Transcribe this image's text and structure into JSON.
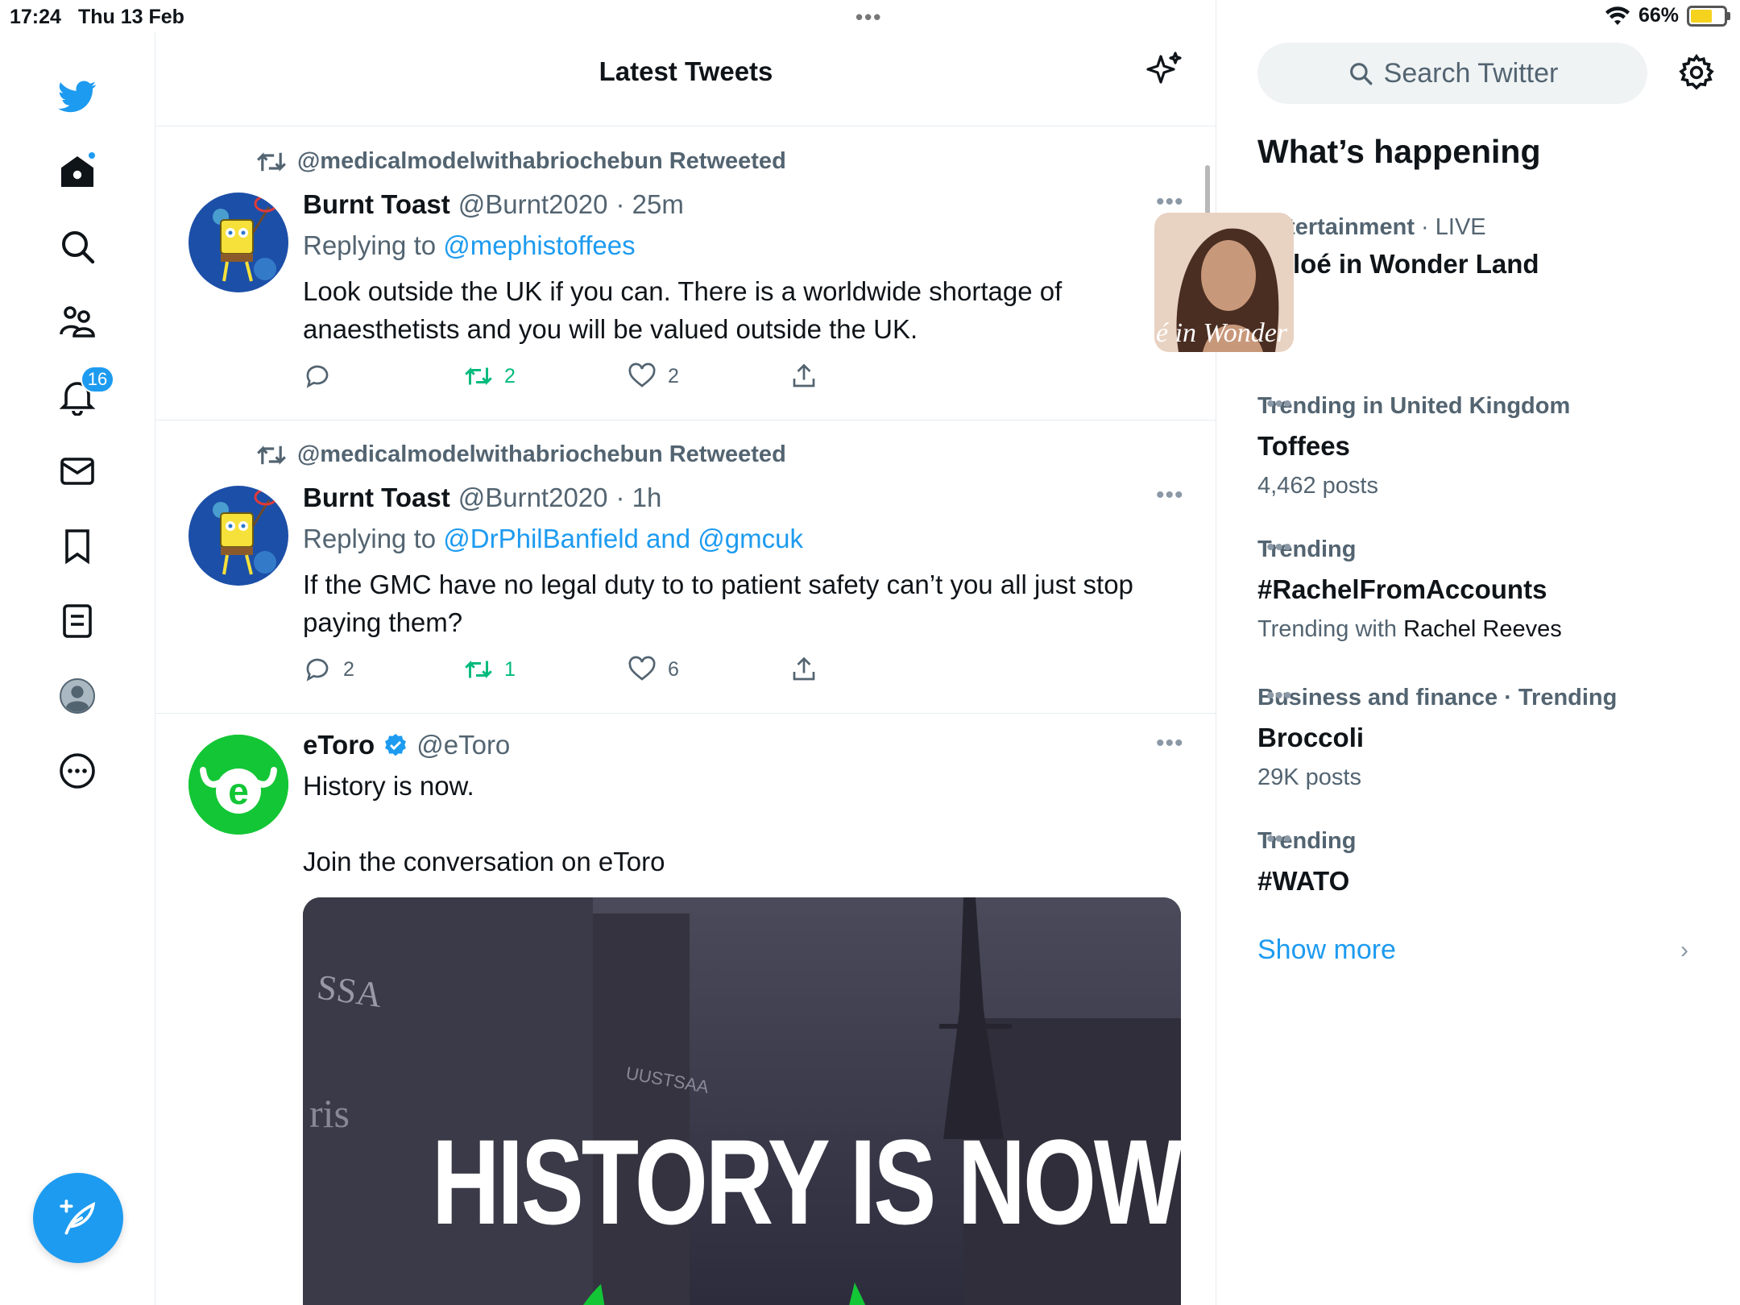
{
  "status": {
    "time": "17:24",
    "date": "Thu 13 Feb",
    "battery": "66%",
    "battery_level": 0.66
  },
  "sidebar": {
    "notifications_badge": "16"
  },
  "header": {
    "title": "Latest Tweets"
  },
  "tweets": [
    {
      "retweeted_by": "@medicalmodelwithabriochebun Retweeted",
      "name": "Burnt Toast",
      "handle": "@Burnt2020",
      "time": "· 25m",
      "replying_prefix": "Replying to",
      "replying_to": "@mephistoffees",
      "text": "Look outside the UK if you can. There is a worldwide shortage of anaesthetists and you will be valued outside the UK.",
      "replies": "",
      "retweets": "2",
      "likes": "2"
    },
    {
      "retweeted_by": "@medicalmodelwithabriochebun Retweeted",
      "name": "Burnt Toast",
      "handle": "@Burnt2020",
      "time": "· 1h",
      "replying_prefix": "Replying to",
      "replying_to": "@DrPhilBanfield and @gmcuk",
      "text": "If the GMC have no legal duty to to patient safety can’t you all just stop paying them?",
      "replies": "2",
      "retweets": "1",
      "likes": "6"
    },
    {
      "name": "eToro",
      "handle": "@eToro",
      "line1": "History is now.",
      "line2": "Join the conversation on eToro",
      "media_text_a": "HISTORY IS ",
      "media_text_b": "NOW",
      "media_sign": "SSA",
      "media_sign2": "UUSTSAA",
      "media_sign3": "ris"
    }
  ],
  "search": {
    "placeholder": "Search Twitter"
  },
  "whats_happening": {
    "title": "What’s happening",
    "items": [
      {
        "category": "Entertainment",
        "meta_suffix": "· LIVE",
        "title": "Khloé in Wonder Land",
        "thumb_text": "é in Wonder L"
      },
      {
        "category": "Trending in United Kingdom",
        "title": "Toffees",
        "sub": "4,462 posts"
      },
      {
        "category": "Trending",
        "title": "#RachelFromAccounts",
        "sub_prefix": "Trending with",
        "sub_name": "Rachel Reeves"
      },
      {
        "category": "Business and finance · Trending",
        "title": "Broccoli",
        "sub": "29K posts"
      },
      {
        "category": "Trending",
        "title": "#WATO"
      }
    ],
    "show_more": "Show more"
  },
  "colors": {
    "accent": "#1d9bf0",
    "retweet_green": "#00ba7c",
    "etoro_green": "#13c636"
  }
}
